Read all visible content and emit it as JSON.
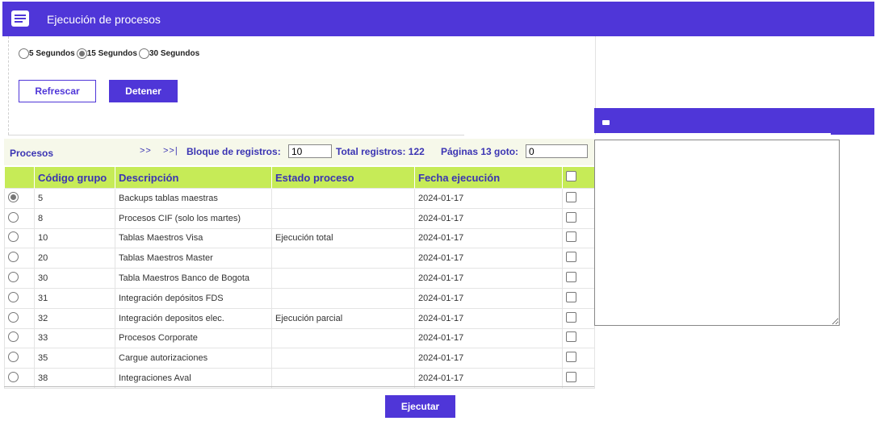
{
  "header": {
    "title": "Ejecución de procesos",
    "icon": "list-window-icon"
  },
  "interval": {
    "options": [
      {
        "label": "5 Segundos",
        "selected": false
      },
      {
        "label": "15 Segundos",
        "selected": true
      },
      {
        "label": "30 Segundos",
        "selected": false
      }
    ]
  },
  "buttons": {
    "refresh": "Refrescar",
    "stop": "Detener",
    "run": "Ejecutar"
  },
  "toolbar": {
    "title": "Procesos",
    "nav_next": ">>",
    "nav_last": ">>|",
    "block_label": "Bloque de registros:",
    "block_value": "10",
    "total_label": "Total registros: 122",
    "pages_label": "Páginas 13 goto:",
    "goto_value": "0"
  },
  "table": {
    "columns": [
      "Código grupo",
      "Descripción",
      "Estado proceso",
      "Fecha ejecución"
    ],
    "rows": [
      {
        "selected": true,
        "code": "5",
        "desc": "Backups tablas maestras",
        "status": "",
        "date": "2024-01-17"
      },
      {
        "selected": false,
        "code": "8",
        "desc": "Procesos CIF (solo los martes)",
        "status": "",
        "date": "2024-01-17"
      },
      {
        "selected": false,
        "code": "10",
        "desc": "Tablas Maestros Visa",
        "status": "Ejecución total",
        "date": "2024-01-17"
      },
      {
        "selected": false,
        "code": "20",
        "desc": "Tablas Maestros Master",
        "status": "",
        "date": "2024-01-17"
      },
      {
        "selected": false,
        "code": "30",
        "desc": "Tabla Maestros Banco de Bogota",
        "status": "",
        "date": "2024-01-17"
      },
      {
        "selected": false,
        "code": "31",
        "desc": "Integración depósitos FDS",
        "status": "",
        "date": "2024-01-17"
      },
      {
        "selected": false,
        "code": "32",
        "desc": "Integración depositos elec.",
        "status": "Ejecución parcial",
        "date": "2024-01-17"
      },
      {
        "selected": false,
        "code": "33",
        "desc": "Procesos Corporate",
        "status": "",
        "date": "2024-01-17"
      },
      {
        "selected": false,
        "code": "35",
        "desc": "Cargue autorizaciones",
        "status": "",
        "date": "2024-01-17"
      },
      {
        "selected": false,
        "code": "38",
        "desc": "Integraciones Aval",
        "status": "",
        "date": "2024-01-17"
      }
    ]
  },
  "colors": {
    "accent": "#4f36d8",
    "header_row": "#c6eb57",
    "status_total": "#2222cc",
    "status_partial": "#dd1f1f"
  }
}
